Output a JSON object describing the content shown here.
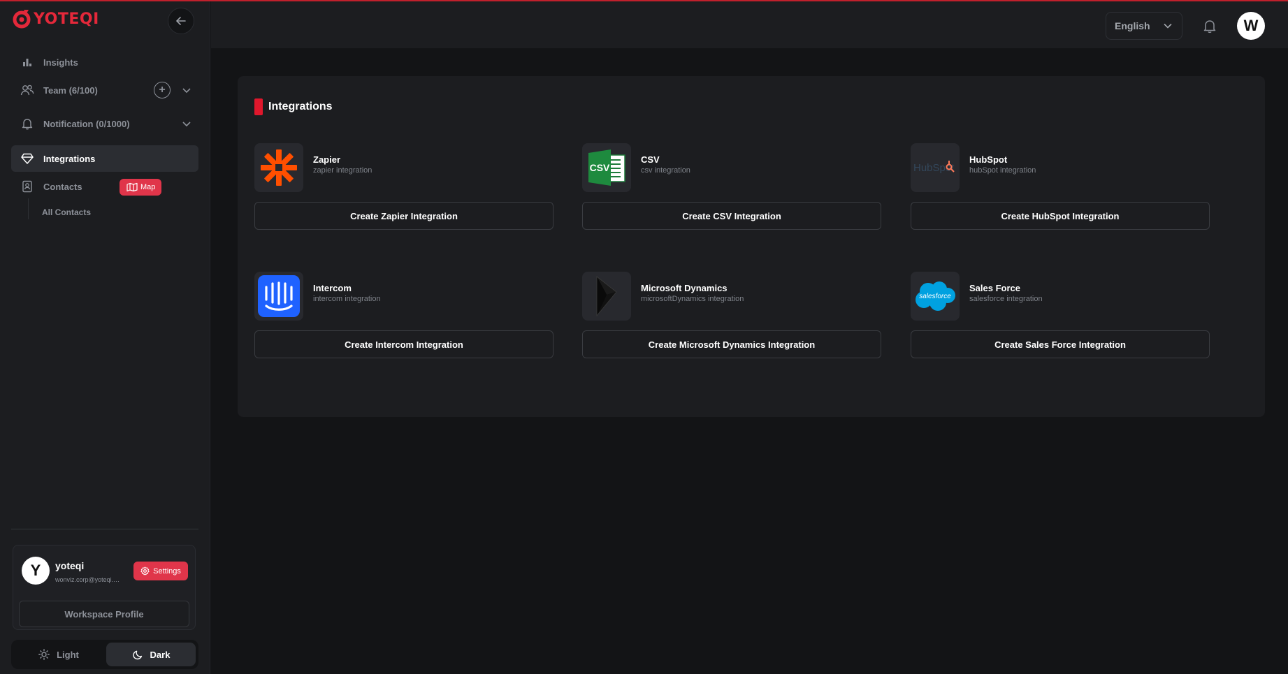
{
  "app": {
    "logo_text": "YOTEQI",
    "brand_color": "#e4283a",
    "accent_color": "#e0354a"
  },
  "sidebar": {
    "items": [
      {
        "label": "Insights",
        "icon": "bar-chart-icon"
      },
      {
        "label": "Team (6/100)",
        "icon": "team-icon"
      },
      {
        "label": "Notification (0/1000)",
        "icon": "bell-icon"
      },
      {
        "label": "Integrations",
        "icon": "diamond-icon"
      },
      {
        "label": "Contacts",
        "icon": "contacts-icon"
      }
    ],
    "map_badge": "Map",
    "sub_items": [
      {
        "label": "All Contacts"
      }
    ]
  },
  "profile": {
    "avatar_letter": "Y",
    "name": "yoteqi",
    "email": "wonviz.corp@yoteqi.com",
    "settings_label": "Settings",
    "workspace_label": "Workspace Profile"
  },
  "theme": {
    "light_label": "Light",
    "dark_label": "Dark",
    "selected": "Dark"
  },
  "header": {
    "language": "English",
    "avatar_letter": "W"
  },
  "main": {
    "title": "Integrations",
    "integrations": [
      {
        "name": "Zapier",
        "desc": "zapier integration",
        "button": "Create Zapier Integration",
        "icon": "zapier-icon"
      },
      {
        "name": "CSV",
        "desc": "csv integration",
        "button": "Create CSV Integration",
        "icon": "csv-icon"
      },
      {
        "name": "HubSpot",
        "desc": "hubSpot integration",
        "button": "Create HubSpot Integration",
        "icon": "hubspot-icon"
      },
      {
        "name": "Intercom",
        "desc": "intercom integration",
        "button": "Create Intercom Integration",
        "icon": "intercom-icon"
      },
      {
        "name": "Microsoft Dynamics",
        "desc": "microsoftDynamics integration",
        "button": "Create Microsoft Dynamics Integration",
        "icon": "microsoft-dynamics-icon"
      },
      {
        "name": "Sales Force",
        "desc": "salesforce integration",
        "button": "Create Sales Force Integration",
        "icon": "salesforce-icon"
      }
    ],
    "csv_logo_text": "CSV",
    "hubspot_logo_text": "HubSpot",
    "salesforce_logo_text": "salesforce"
  }
}
